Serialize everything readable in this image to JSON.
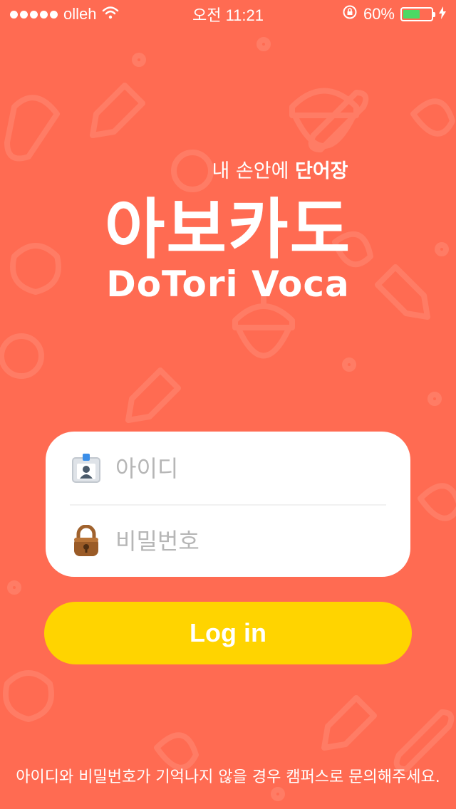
{
  "status_bar": {
    "carrier": "olleh",
    "time": "오전 11:21",
    "battery": "60%",
    "battery_level": 0.6
  },
  "logo": {
    "tagline_prefix": "내 손안에 ",
    "tagline_bold": "단어장",
    "title_ko": "아보카도",
    "title_en": "DoTori Voca"
  },
  "login": {
    "id_placeholder": "아이디",
    "password_placeholder": "비밀번호",
    "button_label": "Log in"
  },
  "help_text": "아이디와 비밀번호가 기억나지 않을 경우 캠퍼스로 문의해주세요.",
  "colors": {
    "background": "#ff6b52",
    "button": "#ffd400",
    "battery": "#4cd964"
  }
}
